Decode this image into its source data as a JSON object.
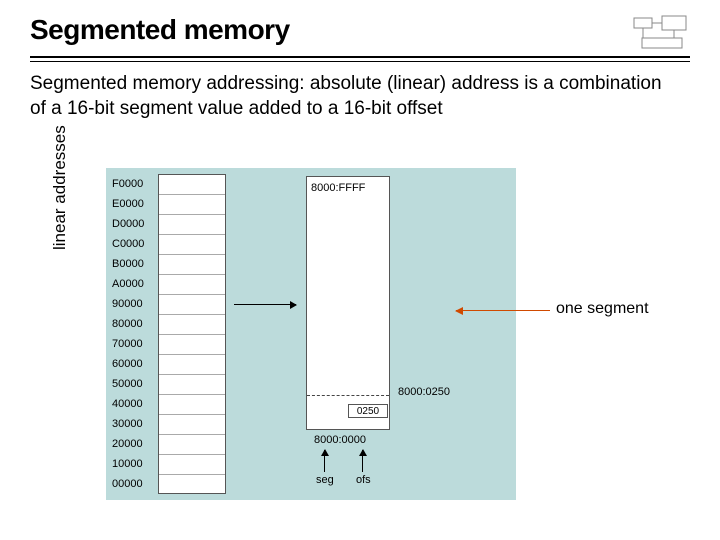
{
  "title": "Segmented memory",
  "description": "Segmented memory addressing: absolute (linear) address is a combination of a 16-bit segment value added to a 16-bit offset",
  "vert_axis_label": "linear addresses",
  "one_segment_label": "one segment",
  "addresses": [
    "F0000",
    "E0000",
    "D0000",
    "C0000",
    "B0000",
    "A0000",
    "90000",
    "80000",
    "70000",
    "60000",
    "50000",
    "40000",
    "30000",
    "20000",
    "10000",
    "00000"
  ],
  "seg_top_label": "8000:FFFF",
  "seg_bottom_label": "8000:0000",
  "offset_label": "8000:0250",
  "offset_value": "0250",
  "bottom_seg": "seg",
  "bottom_ofs": "ofs"
}
